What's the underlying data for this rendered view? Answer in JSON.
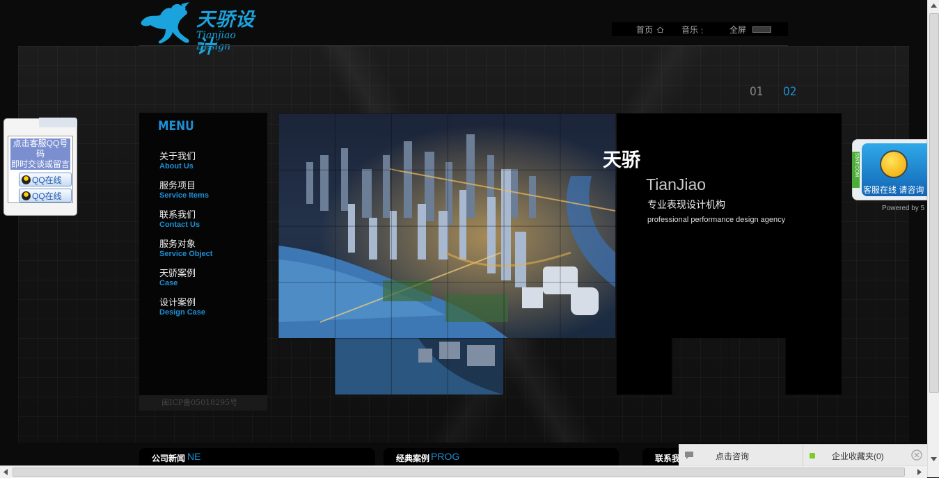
{
  "header": {
    "logo_cn": "天骄设计",
    "logo_en": "Tianjiao Design",
    "nav": [
      {
        "label": "首页",
        "icon": "home-icon"
      },
      {
        "label": "音乐",
        "icon": "music-icon"
      },
      {
        "label": "全屏",
        "icon": "fullscreen-icon"
      }
    ]
  },
  "pager": {
    "p1": "01",
    "p2": "02",
    "active": "02"
  },
  "menu": {
    "title": "MENU",
    "items": [
      {
        "zh": "关于我们",
        "en": "About Us"
      },
      {
        "zh": "服务项目",
        "en": "Service Items"
      },
      {
        "zh": "联系我们",
        "en": "Contact Us"
      },
      {
        "zh": "服务对象",
        "en": "Service Object"
      },
      {
        "zh": "天骄案例",
        "en": "Case"
      },
      {
        "zh": "设计案例",
        "en": "Design Case"
      }
    ],
    "icp": "闽ICP备05018295号"
  },
  "banner": {
    "title": "天骄",
    "subtitle": "TianJiao",
    "slogan_cn": "专业表现设计机构",
    "slogan_en": "professional performance design agency"
  },
  "qq_left": {
    "header_line1": "点击客服QQ号码",
    "header_line2": "即时交谈或留言",
    "buttons": [
      "QQ在线",
      "QQ在线"
    ]
  },
  "qq_right": {
    "side_label": "53KF.COM",
    "label": "客服在线 请咨询",
    "powered": "Powered by 5"
  },
  "bottom": {
    "news_cn": "公司新闻",
    "news_en": "NE",
    "cases_cn": "经典案例",
    "cases_en": "PROG",
    "contact_cn": "联系我",
    "consult": "点击咨询",
    "favorites": "企业收藏夹(0)"
  },
  "colors": {
    "accent": "#1e8fd5",
    "background": "#0b0b0b"
  }
}
